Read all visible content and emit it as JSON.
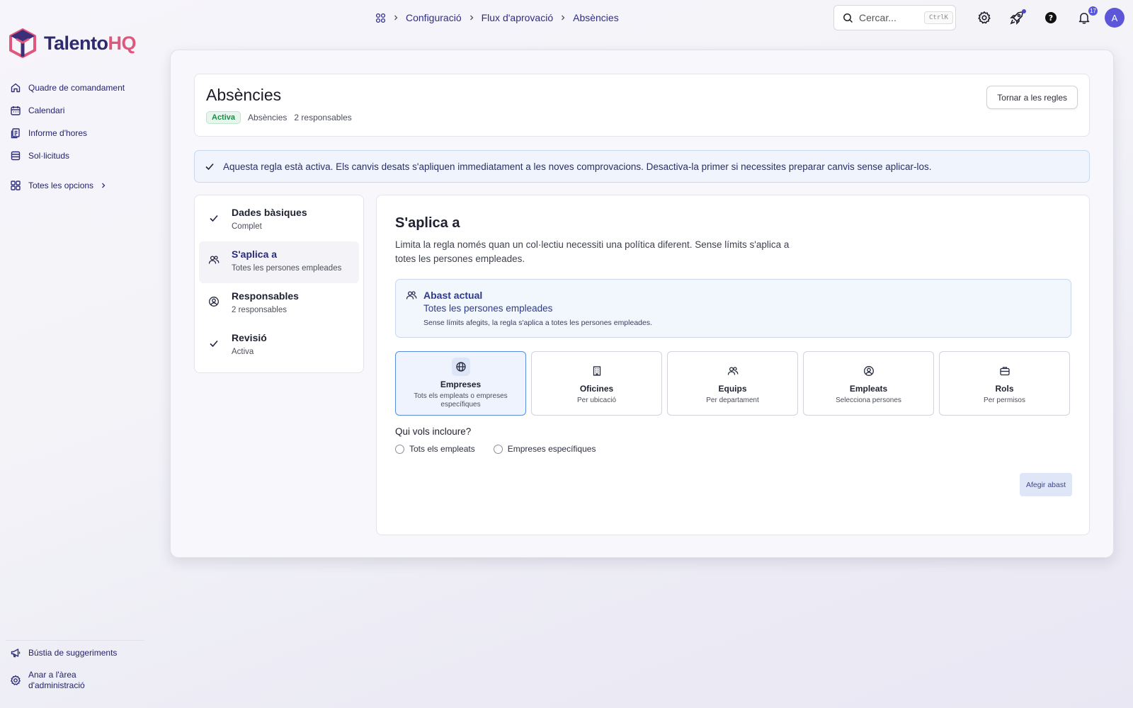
{
  "app": {
    "logo_part1": "Talento",
    "logo_part2": "HQ",
    "brand_color": "#e0577d",
    "accent_color": "#5b57d8"
  },
  "sidebar": {
    "items": [
      {
        "label": "Quadre de comandament",
        "icon": "home-icon"
      },
      {
        "label": "Calendari",
        "icon": "calendar-icon"
      },
      {
        "label": "Informe d'hores",
        "icon": "report-icon"
      },
      {
        "label": "Sol·licituds",
        "icon": "list-icon"
      }
    ],
    "all_options": "Totes les opcions",
    "bottom": {
      "suggestions": "Bústia de suggeriments",
      "admin": "Anar a l'àrea d'administració"
    }
  },
  "topbar": {
    "breadcrumb": [
      "Configuració",
      "Flux d'aprovació",
      "Absències"
    ],
    "search_placeholder": "Cercar...",
    "search_shortcut": "CtrlK",
    "notifications_count": "17",
    "avatar_initial": "A"
  },
  "header": {
    "title": "Absències",
    "status": "Activa",
    "category": "Absències",
    "responsables": "2 responsables",
    "back_button": "Tornar a les regles"
  },
  "alert": {
    "text": "Aquesta regla està activa. Els canvis desats s'apliquen immediatament a les noves comprovacions. Desactiva-la primer si necessites preparar canvis sense aplicar-los."
  },
  "steps": [
    {
      "title": "Dades bàsiques",
      "subtitle": "Complet",
      "icon": "check-icon",
      "active": false
    },
    {
      "title": "S'aplica a",
      "subtitle": "Totes les persones empleades",
      "icon": "users-icon",
      "active": true
    },
    {
      "title": "Responsables",
      "subtitle": "2 responsables",
      "icon": "user-circle-icon",
      "active": false
    },
    {
      "title": "Revisió",
      "subtitle": "Activa",
      "icon": "check-icon",
      "active": false
    }
  ],
  "content": {
    "title": "S'aplica a",
    "description": "Limita la regla només quan un col·lectiu necessiti una política diferent. Sense límits s'aplica a totes les persones empleades.",
    "scope": {
      "title": "Abast actual",
      "value": "Totes les persones empleades",
      "note": "Sense límits afegits, la regla s'aplica a totes les persones empleades."
    },
    "options": [
      {
        "title": "Empreses",
        "subtitle": "Tots els empleats o empreses específiques",
        "icon": "globe-icon",
        "selected": true
      },
      {
        "title": "Oficines",
        "subtitle": "Per ubicació",
        "icon": "building-icon",
        "selected": false
      },
      {
        "title": "Equips",
        "subtitle": "Per departament",
        "icon": "users-icon",
        "selected": false
      },
      {
        "title": "Empleats",
        "subtitle": "Selecciona persones",
        "icon": "user-circle-icon",
        "selected": false
      },
      {
        "title": "Rols",
        "subtitle": "Per permisos",
        "icon": "briefcase-icon",
        "selected": false
      }
    ],
    "question": "Qui vols incloure?",
    "radios": [
      "Tots els empleats",
      "Empreses específiques"
    ],
    "add_button": "Afegir abast"
  }
}
